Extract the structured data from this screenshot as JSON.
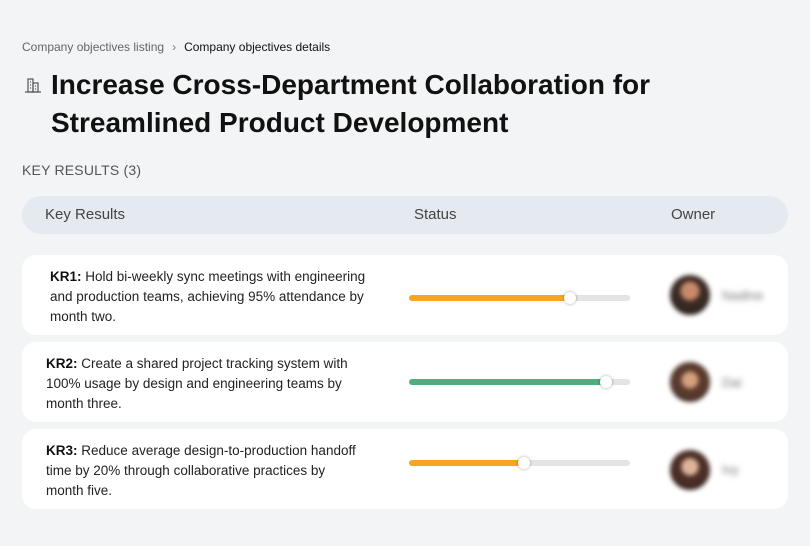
{
  "breadcrumb": {
    "parent": "Company objectives listing",
    "separator": "›",
    "current": "Company objectives details"
  },
  "objective": {
    "icon": "building-icon",
    "title": "Increase Cross-Department Collaboration for Streamlined Product Development"
  },
  "key_results_label": "KEY RESULTS (3)",
  "table": {
    "columns": [
      "Key Results",
      "Status",
      "Owner"
    ]
  },
  "key_results": [
    {
      "id": "KR1:",
      "text": "Hold bi-weekly sync meetings with engineering and production teams, achieving 95% attendance by month two.",
      "progress": 0.73,
      "color": "#f6a623",
      "owner": "Nadine"
    },
    {
      "id": "KR2:",
      "text": "Create a shared project tracking system with 100% usage by design and engineering teams by month three.",
      "progress": 0.89,
      "color": "#4caf7d",
      "owner": "Dai"
    },
    {
      "id": "KR3:",
      "text": "Reduce average design-to-production handoff time by 20% through collaborative practices by month five.",
      "progress": 0.52,
      "color": "#f6a623",
      "owner": "Ivy"
    }
  ]
}
